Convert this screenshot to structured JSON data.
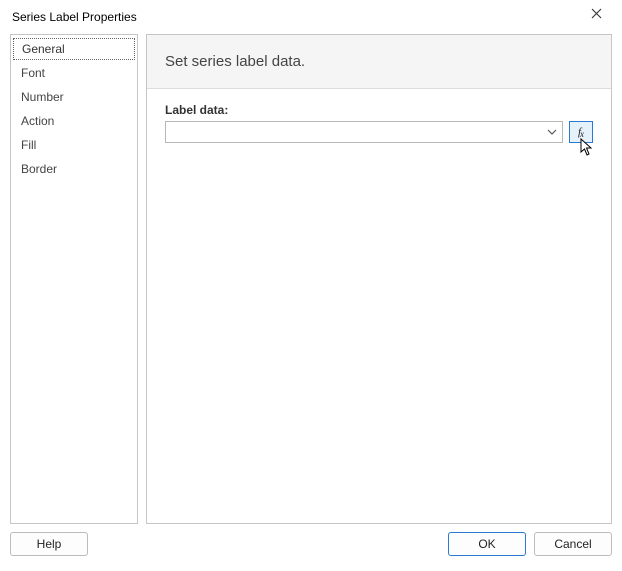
{
  "window": {
    "title": "Series Label Properties"
  },
  "sidebar": {
    "items": [
      {
        "label": "General"
      },
      {
        "label": "Font"
      },
      {
        "label": "Number"
      },
      {
        "label": "Action"
      },
      {
        "label": "Fill"
      },
      {
        "label": "Border"
      }
    ]
  },
  "panel": {
    "heading": "Set series label data.",
    "label_data_label": "Label data:",
    "label_data_value": "",
    "fx_label": "f",
    "fx_sub": "x"
  },
  "footer": {
    "help": "Help",
    "ok": "OK",
    "cancel": "Cancel"
  }
}
